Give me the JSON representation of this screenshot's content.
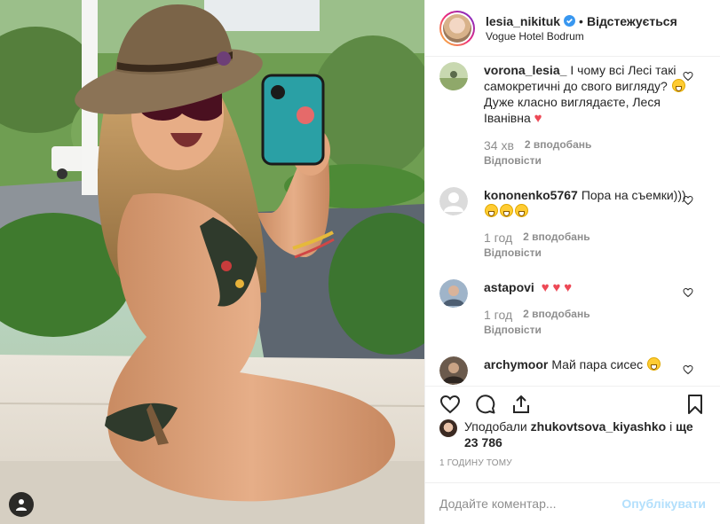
{
  "post": {
    "user_tag_icon": "user-tag-icon"
  },
  "header": {
    "username": "lesia_nikituk",
    "separator": "•",
    "follow_label": "Відстежується",
    "location": "Vogue Hotel Bodrum",
    "verified_icon": "verified-badge-icon"
  },
  "comments": [
    {
      "username": "vorona_lesia_",
      "text_before": "І чому всі Лесі такі самокретичні до свого вигляду?",
      "text_after": "Дуже класно виглядаєте, Леся Іванівна",
      "time": "34 хв",
      "likes": "2 вподобань",
      "reply": "Відповісти"
    },
    {
      "username": "kononenko5767",
      "text_before": "Пора на съемки)))",
      "time": "1 год",
      "likes": "2 вподобань",
      "reply": "Відповісти"
    },
    {
      "username": "astapovi",
      "time": "1 год",
      "likes": "2 вподобань",
      "reply": "Відповісти"
    },
    {
      "username": "archymoor",
      "text_before": "Май пара сисес"
    }
  ],
  "likes": {
    "prefix": "Уподобали",
    "liker": "zhukovtsova_kiyashko",
    "middle": "і",
    "count": "ще 23 786"
  },
  "time_ago": "1 ГОДИНУ ТОМУ",
  "add_comment": {
    "placeholder": "Додайте коментар...",
    "post_label": "Опублікувати"
  },
  "colors": {
    "verified": "#3897f0",
    "heart": "#ed4956",
    "post_button": "#b2dffc",
    "muted": "#8e8e8e"
  }
}
